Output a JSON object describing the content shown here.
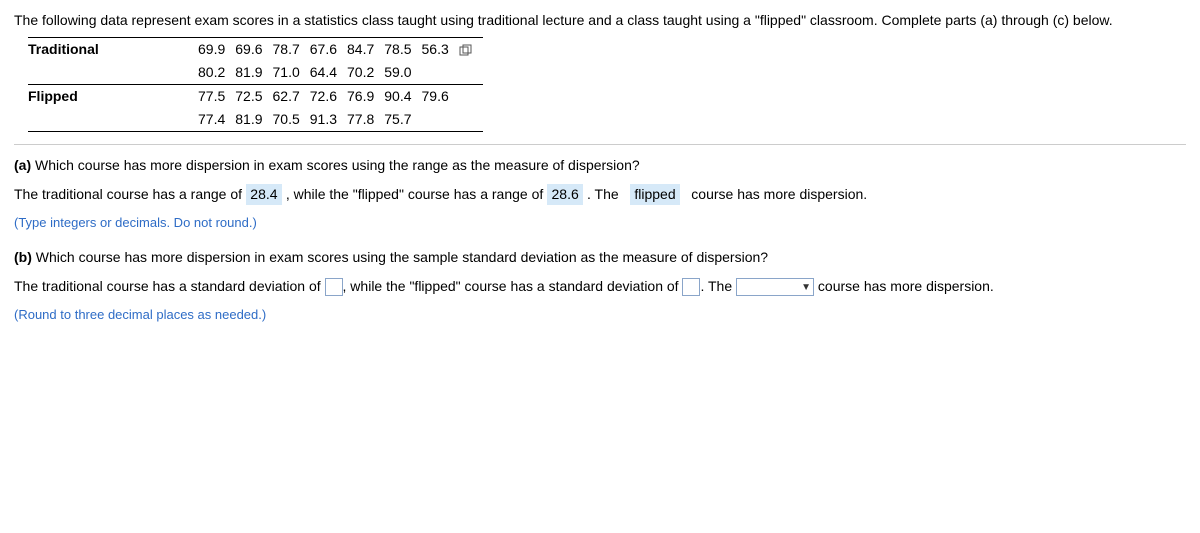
{
  "intro": "The following data represent exam scores in a statistics class taught using traditional lecture and a class taught using a \"flipped\" classroom. Complete parts (a) through (c) below.",
  "table": {
    "rows": [
      {
        "label": "Traditional",
        "r1": [
          "69.9",
          "69.6",
          "78.7",
          "67.6",
          "84.7",
          "78.5",
          "56.3"
        ],
        "r2": [
          "80.2",
          "81.9",
          "71.0",
          "64.4",
          "70.2",
          "59.0",
          ""
        ]
      },
      {
        "label": "Flipped",
        "r1": [
          "77.5",
          "72.5",
          "62.7",
          "72.6",
          "76.9",
          "90.4",
          "79.6"
        ],
        "r2": [
          "77.4",
          "81.9",
          "70.5",
          "91.3",
          "77.8",
          "75.7",
          ""
        ]
      }
    ]
  },
  "a": {
    "label": "(a)",
    "question": "Which course has more dispersion in exam scores using the range as the measure of dispersion?",
    "text1": "The traditional course has a range of",
    "val1": "28.4",
    "text2": ", while the \"flipped\" course has a range of",
    "val2": "28.6",
    "text3": ". The",
    "val3": "flipped",
    "text4": "course has more dispersion.",
    "hint": "(Type integers or decimals. Do not round.)"
  },
  "b": {
    "label": "(b)",
    "question": "Which course has more dispersion in exam scores using the sample standard deviation as the measure of dispersion?",
    "text1": "The traditional course has a standard deviation of",
    "text2": ", while the \"flipped\" course has a standard deviation of",
    "text3": ". The",
    "text4": "course has more dispersion.",
    "hint": "(Round to three decimal places as needed.)"
  }
}
